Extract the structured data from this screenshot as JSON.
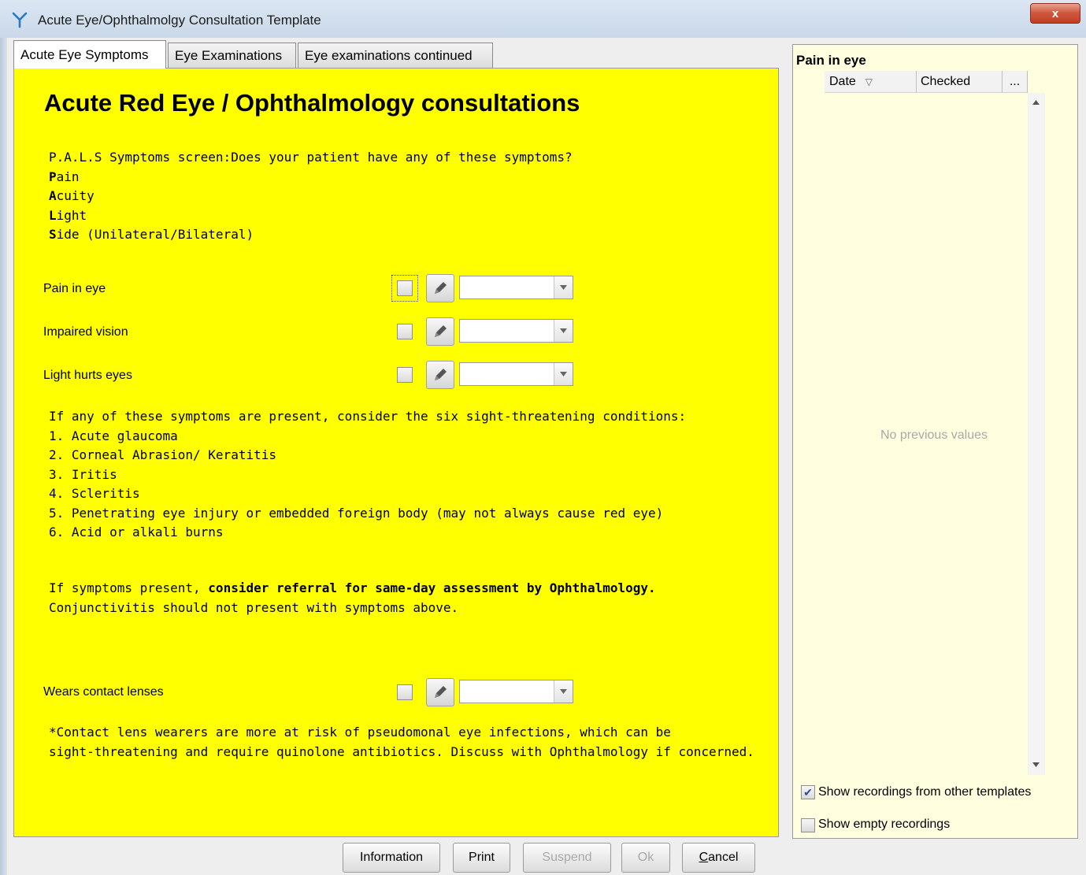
{
  "window": {
    "title": "Acute Eye/Ophthalmolgy Consultation Template",
    "close_label": "x"
  },
  "tabs": [
    {
      "label": "Acute Eye Symptoms",
      "active": true
    },
    {
      "label": "Eye Examinations",
      "active": false
    },
    {
      "label": "Eye examinations continued",
      "active": false
    }
  ],
  "main": {
    "heading": "Acute Red Eye / Ophthalmology consultations",
    "pals_intro": "P.A.L.S Symptoms screen:Does your patient have any of these symptoms?",
    "pals_items": [
      {
        "initial": "P",
        "rest": "ain"
      },
      {
        "initial": "A",
        "rest": "cuity"
      },
      {
        "initial": "L",
        "rest": "ight"
      },
      {
        "initial": "S",
        "rest": "ide (Unilateral/Bilateral)"
      }
    ],
    "fields": [
      {
        "label": "Pain in eye",
        "checked": false,
        "focused": true,
        "value": ""
      },
      {
        "label": "Impaired vision",
        "checked": false,
        "focused": false,
        "value": ""
      },
      {
        "label": "Light hurts eyes",
        "checked": false,
        "focused": false,
        "value": ""
      }
    ],
    "conditions_intro": "If any of these symptoms are present, consider the six sight-threatening conditions:",
    "conditions": [
      "1. Acute glaucoma",
      "2. Corneal Abrasion/ Keratitis",
      "3. Iritis",
      "4. Scleritis",
      "5. Penetrating eye injury or embedded foreign body (may not always cause red eye)",
      "6. Acid or alkali burns"
    ],
    "referral_prefix": "If symptoms present, ",
    "referral_bold": "consider referral for same-day assessment by Ophthalmology.",
    "referral_line2": "Conjunctivitis should not present with symptoms above.",
    "contact_field": {
      "label": "Wears contact lenses",
      "checked": false,
      "value": ""
    },
    "contact_note_line1": "*Contact lens wearers are more at risk of pseudomonal eye infections, which can be",
    "contact_note_line2": "sight-threatening and require quinolone antibiotics. Discuss with Ophthalmology if concerned."
  },
  "side_panel": {
    "title": "Pain in eye",
    "columns": [
      "Date",
      "Checked",
      "..."
    ],
    "sort_indicator": "▽",
    "empty_text": "No previous values",
    "show_other_templates": {
      "label": "Show recordings from other templates",
      "checked": true
    },
    "show_empty": {
      "label": "Show empty recordings",
      "checked": false
    }
  },
  "buttons": {
    "information": "Information",
    "print": "Print",
    "suspend": "Suspend",
    "ok": "Ok",
    "cancel_first": "C",
    "cancel_rest": "ancel"
  },
  "colors": {
    "panel_background": "#ffff00",
    "side_background": "#ffffe0",
    "close_button": "#c13d24"
  }
}
